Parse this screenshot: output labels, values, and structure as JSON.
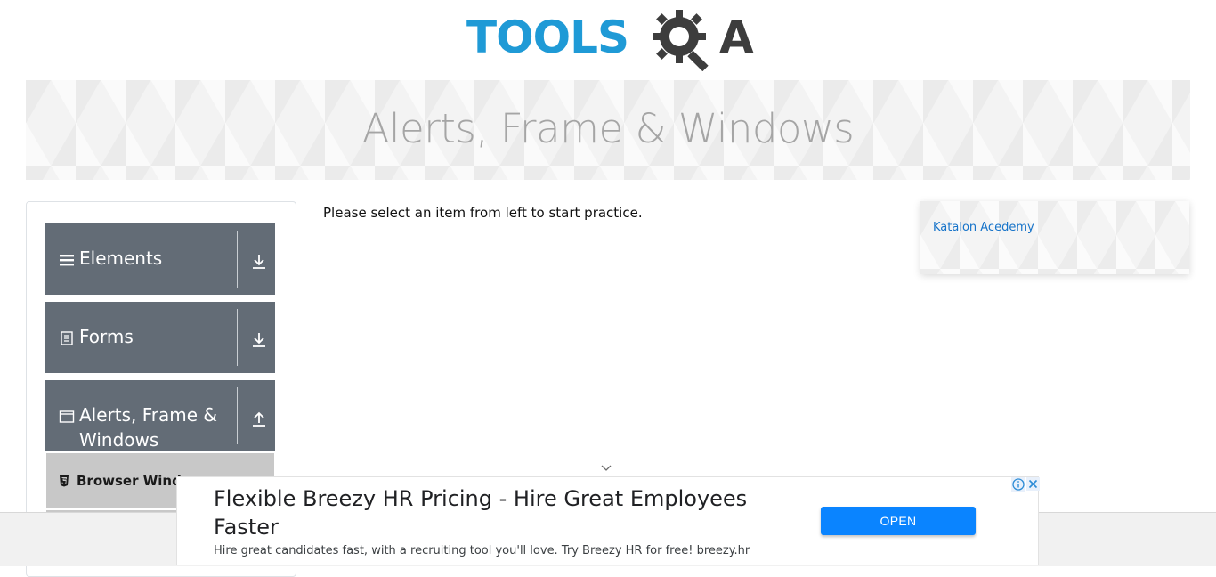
{
  "logo": {
    "text": "TOOLS",
    "suffix": "A"
  },
  "banner": {
    "title": "Alerts, Frame & Windows"
  },
  "sidebar": {
    "groups": [
      {
        "label": "Elements",
        "icon": "hamburger-icon",
        "expanded": false
      },
      {
        "label": "Forms",
        "icon": "document-icon",
        "expanded": false
      },
      {
        "label": "Alerts, Frame & Windows",
        "icon": "window-icon",
        "expanded": true
      }
    ],
    "sub_items": [
      {
        "label": "Browser Windows",
        "icon": "html5-icon"
      }
    ]
  },
  "main": {
    "instruction": "Please select an item from left to start practice."
  },
  "right_card": {
    "link": "Katalon Acedemy"
  },
  "ad": {
    "title": "Flexible Breezy HR Pricing - Hire Great Employees Faster",
    "description": "Hire great candidates fast, with a recruiting tool you'll love. Try Breezy HR for free! breezy.hr",
    "button": "OPEN"
  },
  "colors": {
    "group_bg": "#636c76",
    "logo_blue": "#1f9ad6",
    "logo_dark": "#3d3d3d",
    "ad_button": "#0a84ff",
    "link": "#1673c9"
  }
}
